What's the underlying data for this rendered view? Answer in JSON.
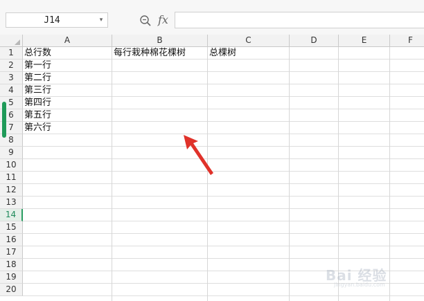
{
  "name_box": {
    "value": "J14"
  },
  "formula_bar": {
    "fx_label": "fx",
    "value": ""
  },
  "columns": [
    "A",
    "B",
    "C",
    "D",
    "E",
    "F"
  ],
  "rows": [
    "1",
    "2",
    "3",
    "4",
    "5",
    "6",
    "7",
    "8",
    "9",
    "10",
    "11",
    "12",
    "13",
    "14",
    "15",
    "16",
    "17",
    "18",
    "19",
    "20"
  ],
  "active_row": "14",
  "cells": {
    "A1": "总行数",
    "B1": "每行栽种棉花棵树",
    "C1": "总棵树",
    "A2": "第一行",
    "A3": "第二行",
    "A4": "第三行",
    "A5": "第四行",
    "A6": "第五行",
    "A7": "第六行"
  },
  "colors": {
    "accent": "#1f9a58",
    "arrow": "#e0322a"
  },
  "watermark": {
    "text": "Bai 经验",
    "sub": "jingyan.baidu.com"
  },
  "icons": {
    "zoom": "zoom-icon",
    "dropdown": "chevron-down-icon"
  }
}
